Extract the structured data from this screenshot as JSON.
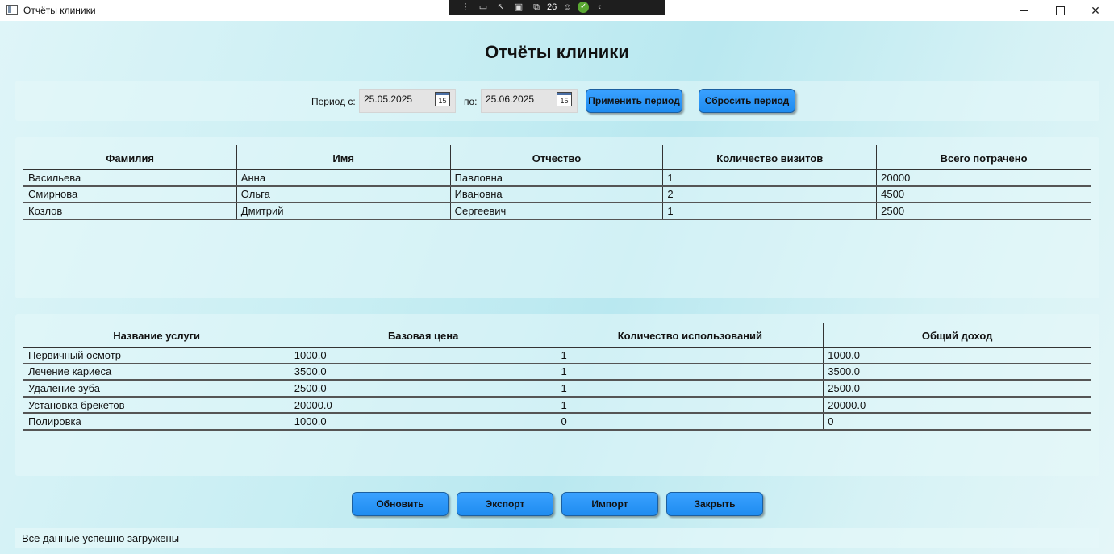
{
  "window": {
    "title": "Отчёты клиники",
    "debug_count": "26"
  },
  "page": {
    "title": "Отчёты клиники"
  },
  "period": {
    "from_label": "Период с:",
    "from_value": "25.05.2025",
    "to_label": "по:",
    "to_value": "25.06.2025",
    "calendar_day": "15",
    "apply_label": "Применить период",
    "reset_label": "Сбросить период"
  },
  "patients_table": {
    "columns": [
      "Фамилия",
      "Имя",
      "Отчество",
      "Количество визитов",
      "Всего потрачено"
    ],
    "rows": [
      [
        "Васильева",
        "Анна",
        "Павловна",
        "1",
        "20000"
      ],
      [
        "Смирнова",
        "Ольга",
        "Ивановна",
        "2",
        "4500"
      ],
      [
        "Козлов",
        "Дмитрий",
        "Сергеевич",
        "1",
        "2500"
      ]
    ]
  },
  "services_table": {
    "columns": [
      "Название услуги",
      "Базовая цена",
      "Количество использований",
      "Общий доход"
    ],
    "rows": [
      [
        "Первичный осмотр",
        "1000.0",
        "1",
        "1000.0"
      ],
      [
        "Лечение кариеса",
        "3500.0",
        "1",
        "3500.0"
      ],
      [
        "Удаление зуба",
        "2500.0",
        "1",
        "2500.0"
      ],
      [
        "Установка брекетов",
        "20000.0",
        "1",
        "20000.0"
      ],
      [
        "Полировка",
        "1000.0",
        "0",
        "0"
      ]
    ]
  },
  "actions": {
    "refresh_label": "Обновить",
    "export_label": "Экспорт",
    "import_label": "Импорт",
    "close_label": "Закрыть"
  },
  "status": {
    "message": "Все данные успешно загружены"
  },
  "colors": {
    "button": "#2a96f8",
    "button_border": "#1b5fa0",
    "background": "#c8eef3"
  }
}
